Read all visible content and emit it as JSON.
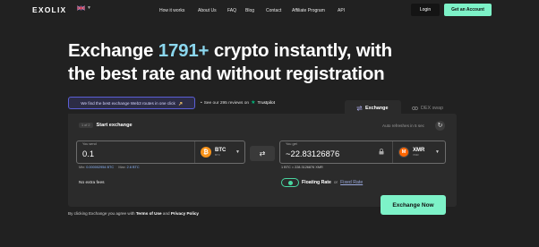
{
  "nav": {
    "logo": "EXOLIX",
    "links": [
      "How it works",
      "About Us",
      "FAQ",
      "Blog",
      "Contact",
      "Affiliate Program",
      "API"
    ],
    "login_label": "Login",
    "account_label": "Get an Account"
  },
  "hero": {
    "title_part1": "Exchange ",
    "title_highlight": "1791+",
    "title_part2": " crypto instantly, with",
    "title_line2": "the best rate and without registration"
  },
  "banner": {
    "text": "We find the best exchange Web3 routes in one click",
    "icon": "pointer-icon"
  },
  "trustpilot": {
    "text": "See our 295 reviews on",
    "brand": "Trustpilot"
  },
  "widget": {
    "tabs": [
      {
        "label": "Exchange",
        "icon": "exchange-icon",
        "active": true
      },
      {
        "label": "DEX swap",
        "icon": "dex-icon",
        "active": false
      }
    ],
    "step_badge": "1 of 2",
    "step_title": "Start exchange",
    "auto_refresh": "Auto refreshes in 5 sec",
    "send": {
      "label": "You send",
      "value": "0.1",
      "currency": "BTC",
      "network": "BTC",
      "min_label": "Min:",
      "min_value": "0.000002954 BTC",
      "max_label": "Max:",
      "max_value": "2.6 BTC"
    },
    "get": {
      "label": "You get",
      "value": "~22.83126876",
      "currency": "XMR",
      "network": "XMR"
    },
    "rate_text": "1 BTC = 228.3126876 XMR",
    "extra_fees": "No extra fees",
    "floating_rate": "Floating Rate",
    "or": "or",
    "fixed_rate": "Fixed Rate",
    "exchange_button": "Exchange Now"
  },
  "terms": {
    "prefix": "By clicking Exchange you agree with ",
    "terms_link": "Terms of Use",
    "and": " and ",
    "privacy_link": "Privacy Policy"
  },
  "colors": {
    "background": "#212121",
    "card": "#2b2b2b",
    "accent": "#7df2c8",
    "highlight": "#8bd7ee",
    "btc": "#f7931a",
    "xmr": "#ff6600"
  }
}
